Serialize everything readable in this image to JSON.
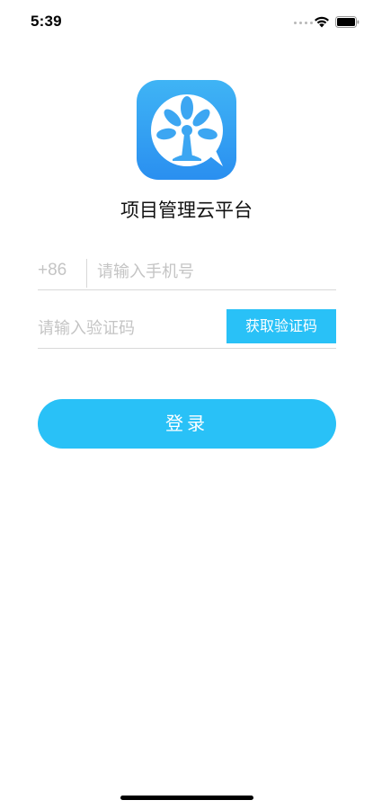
{
  "status_bar": {
    "time": "5:39"
  },
  "app": {
    "title": "项目管理云平台",
    "icon": "tree-logo-icon",
    "brand_color": "#29c1f7"
  },
  "login_form": {
    "country_code": "+86",
    "phone_placeholder": "请输入手机号",
    "phone_value": "",
    "code_placeholder": "请输入验证码",
    "code_value": "",
    "get_code_label": "获取验证码",
    "login_label": "登录"
  }
}
